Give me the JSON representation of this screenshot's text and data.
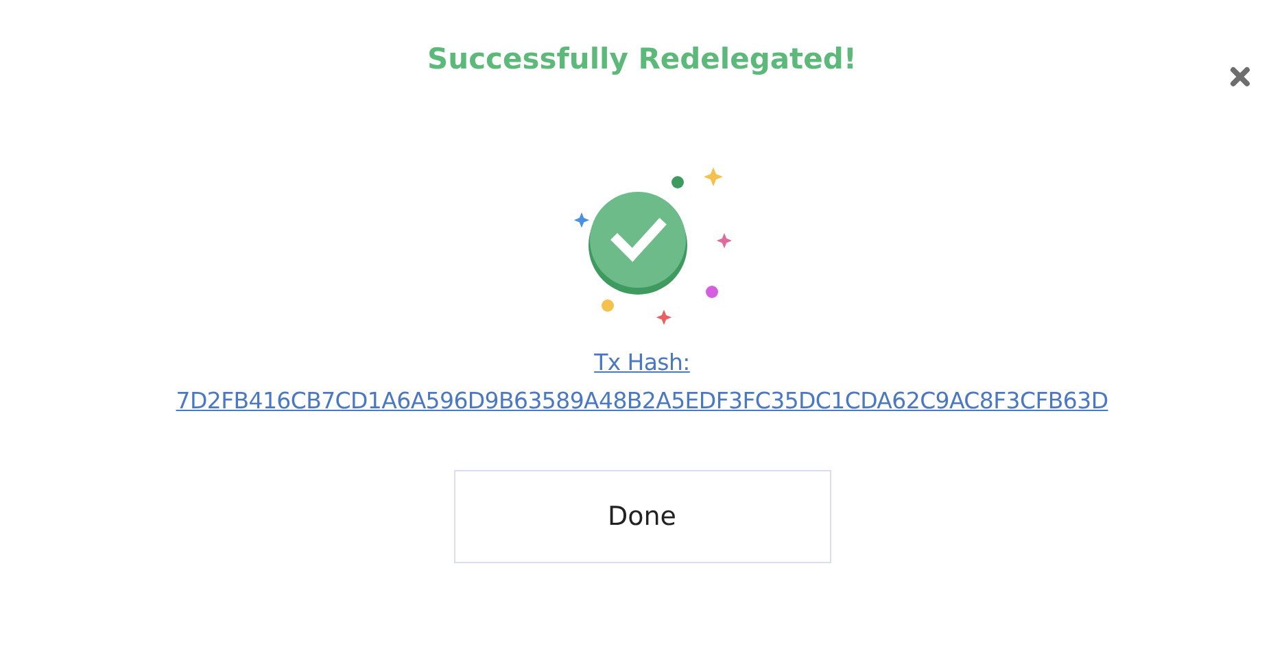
{
  "title": "Successfully Redelegated!",
  "tx_link": {
    "label": "Tx Hash:",
    "hash": "7D2FB416CB7CD1A6A596D9B63589A48B2A5EDF3FC35DC1CDA62C9AC8F3CFB63D"
  },
  "buttons": [
    "Done"
  ]
}
